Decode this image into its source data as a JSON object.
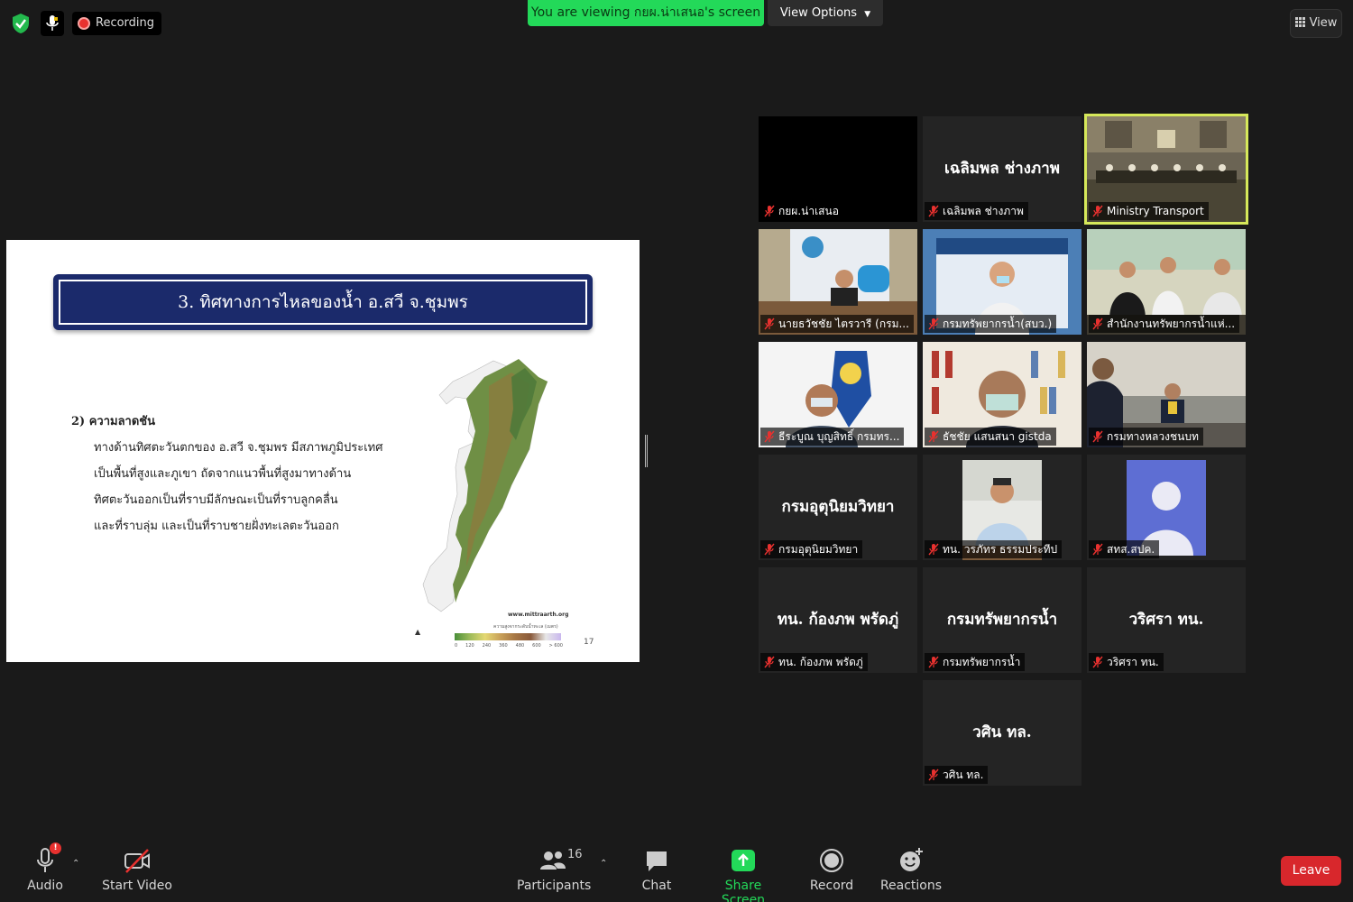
{
  "topbar": {
    "recording_label": "Recording",
    "viewing_banner": "You are viewing กยผ.น่าเสนอ's screen",
    "view_options_label": "View Options",
    "view_label": "View"
  },
  "slide": {
    "title": "3. ทิศทางการไหลของน้ำ อ.สวี จ.ชุมพร",
    "subhead": "2) ความลาดชัน",
    "body": [
      "ทางด้านทิศตะวันตกของ อ.สวี จ.ชุมพร มีสภาพภูมิประเทศ",
      "เป็นพื้นที่สูงและภูเขา ถัดจากแนวพื้นที่สูงมาทางด้าน",
      "ทิศตะวันออกเป็นที่ราบมีลักษณะเป็นที่ราบลูกคลื่น",
      "และที่ราบลุ่ม และเป็นที่ราบชายฝั่งทะเลตะวันออก"
    ],
    "map_credit": "www.mittraarth.org",
    "legend_title": "ความสูงจากระดับน้ำทะเล (เมตร)",
    "legend_ticks": [
      "0",
      "120",
      "240",
      "360",
      "480",
      "600",
      "> 600"
    ],
    "page_number": "17"
  },
  "gallery": [
    {
      "center_name": "",
      "label": "กยผ.น่าเสนอ",
      "active": false,
      "kind": "black"
    },
    {
      "center_name": "เฉลิมพล ช่างภาพ",
      "label": "เฉลิมพล ช่างภาพ",
      "active": false,
      "kind": "name"
    },
    {
      "center_name": "",
      "label": "Ministry Transport",
      "active": true,
      "kind": "room"
    },
    {
      "center_name": "",
      "label": "นายธวัชชัย ไตรวารี (กรม...",
      "active": false,
      "kind": "video1"
    },
    {
      "center_name": "",
      "label": "กรมทรัพยากรน้ำ(สบว.)",
      "active": false,
      "kind": "video2"
    },
    {
      "center_name": "",
      "label": "สำนักงานทรัพยากรน้ำแห่...",
      "active": false,
      "kind": "video3"
    },
    {
      "center_name": "",
      "label": "ธีระบูณ บุญสิทธิ์ กรมทร...",
      "active": false,
      "kind": "video4"
    },
    {
      "center_name": "",
      "label": "ธัชชัย แสนสนา gistda",
      "active": false,
      "kind": "video5"
    },
    {
      "center_name": "",
      "label": "กรมทางหลวงชนบท",
      "active": false,
      "kind": "video6"
    },
    {
      "center_name": "กรมอุตุนิยมวิทยา",
      "label": "กรมอุตุนิยมวิทยา",
      "active": false,
      "kind": "name"
    },
    {
      "center_name": "",
      "label": "ทน. วรภัทร ธรรมประทีป",
      "active": false,
      "kind": "video7"
    },
    {
      "center_name": "",
      "label": "สทส.สปค.",
      "active": false,
      "kind": "avatar"
    },
    {
      "center_name": "ทน. ก้องภพ พรัดภู่",
      "label": "ทน. ก้องภพ พรัดภู่",
      "active": false,
      "kind": "name"
    },
    {
      "center_name": "กรมทรัพยากรน้ำ",
      "label": "กรมทรัพยากรน้ำ",
      "active": false,
      "kind": "name"
    },
    {
      "center_name": "วริศรา ทน.",
      "label": "วริศรา ทน.",
      "active": false,
      "kind": "name"
    },
    {
      "center_name": "วศิน ทล.",
      "label": "วศิน ทล.",
      "active": false,
      "kind": "name"
    }
  ],
  "toolbar": {
    "audio_label": "Audio",
    "audio_badge": "!",
    "video_label": "Start Video",
    "participants_label": "Participants",
    "participants_count": "16",
    "chat_label": "Chat",
    "share_label": "Share Screen",
    "record_label": "Record",
    "reactions_label": "Reactions",
    "leave_label": "Leave"
  },
  "colors": {
    "share_green": "#23d959",
    "leave_red": "#d8272c",
    "active_border": "#d6e85a",
    "slide_title_bg": "#1b2a6b"
  }
}
